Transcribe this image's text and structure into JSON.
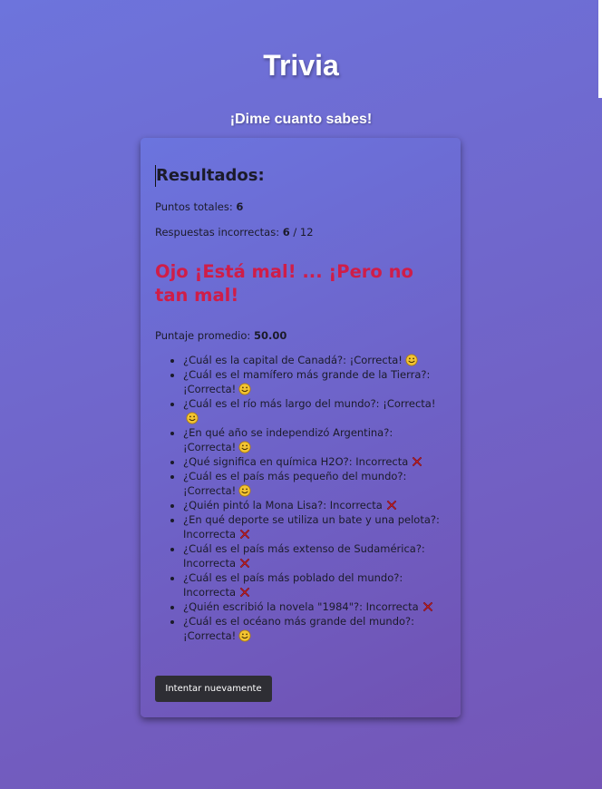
{
  "header": {
    "title": "Trivia",
    "subtitle": "¡Dime cuanto sabes!"
  },
  "results": {
    "heading": "Resultados:",
    "total_points_label": "Puntos totales:",
    "total_points_value": "6",
    "incorrect_label": "Respuestas incorrectas:",
    "incorrect_value": "6",
    "incorrect_total": " / 12",
    "verdict": "Ojo ¡Está mal! ... ¡Pero no tan mal!",
    "verdict_color": "#cf1d48",
    "average_label": "Puntaje promedio:",
    "average_value": "50.00"
  },
  "answers": [
    {
      "text": "¿Cuál es la capital de Canadá?: ¡Correcta!",
      "correct": true
    },
    {
      "text": "¿Cuál es el mamífero más grande de la Tierra?: ¡Correcta!",
      "correct": true
    },
    {
      "text": "¿Cuál es el río más largo del mundo?: ¡Correcta!",
      "correct": true
    },
    {
      "text": "¿En qué año se independizó Argentina?: ¡Correcta!",
      "correct": true
    },
    {
      "text": "¿Qué significa en química H2O?: Incorrecta",
      "correct": false
    },
    {
      "text": "¿Cuál es el país más pequeño del mundo?: ¡Correcta!",
      "correct": true
    },
    {
      "text": "¿Quién pintó la Mona Lisa?: Incorrecta",
      "correct": false
    },
    {
      "text": "¿En qué deporte se utiliza un bate y una pelota?: Incorrecta",
      "correct": false
    },
    {
      "text": "¿Cuál es el país más extenso de Sudamérica?: Incorrecta",
      "correct": false
    },
    {
      "text": "¿Cuál es el país más poblado del mundo?: Incorrecta",
      "correct": false
    },
    {
      "text": "¿Quién escribió la novela \"1984\"?: Incorrecta",
      "correct": false
    },
    {
      "text": "¿Cuál es el océano más grande del mundo?: ¡Correcta!",
      "correct": true
    }
  ],
  "icons": {
    "correct": "smiley-icon",
    "incorrect": "red-x-icon"
  },
  "actions": {
    "retry_label": "Intentar nuevamente"
  },
  "colors": {
    "background_start": "#6d74dc",
    "background_end": "#7455b6",
    "button_background": "#2e2e34"
  }
}
